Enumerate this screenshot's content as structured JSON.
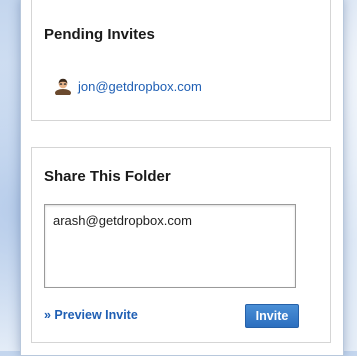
{
  "pending": {
    "title": "Pending Invites",
    "invites": [
      {
        "email": "jon@getdropbox.com",
        "icon": "user-icon"
      }
    ]
  },
  "share": {
    "title": "Share This Folder",
    "email_value": "arash@getdropbox.com",
    "preview_link": "» Preview Invite",
    "invite_button": "Invite"
  },
  "colors": {
    "link": "#1f5fb4",
    "button": "#2c6fbf"
  }
}
